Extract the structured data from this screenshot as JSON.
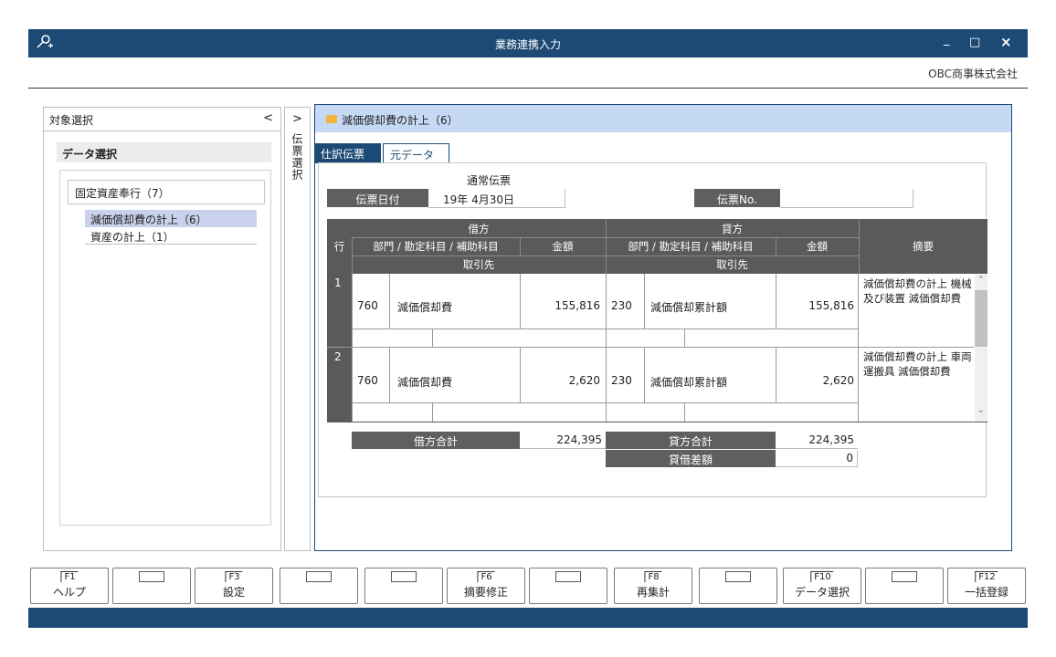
{
  "window": {
    "title": "業務連携入力",
    "icon": "key-plus-icon",
    "minimize": "_",
    "maximize": "□",
    "close": "×"
  },
  "company": "OBC商事株式会社",
  "left_panel": {
    "title": "対象選択",
    "collapse_glyph": "<",
    "section": "データ選択",
    "tree": {
      "root": "固定資産奉行（7）",
      "items": [
        {
          "label": "減価償却費の計上（6）",
          "selected": true
        },
        {
          "label": "資産の計上（1）",
          "selected": false
        }
      ]
    }
  },
  "vtab": {
    "arrow": ">",
    "label": "伝票選択"
  },
  "main": {
    "folder_title": "減価償却費の計上（6）",
    "tabs": [
      "仕訳伝票",
      "元データ"
    ],
    "voucher_type": "通常伝票",
    "date_label": "伝票日付",
    "date_value": "19年 4月30日",
    "no_label": "伝票No.",
    "no_value": "",
    "grid": {
      "row_header": "行",
      "debit_header": "借方",
      "credit_header": "貸方",
      "account_header": "部門 / 勘定科目 / 補助科目",
      "amount_header": "金額",
      "partner_header": "取引先",
      "memo_header": "摘要",
      "rows": [
        {
          "no": "1",
          "debit_dept": "760",
          "debit_account": "減価償却費",
          "debit_amount": "155,816",
          "credit_dept": "230",
          "credit_account": "減価償却累計額",
          "credit_amount": "155,816",
          "memo": "減価償却費の計上 機械及び装置 減価償却費"
        },
        {
          "no": "2",
          "debit_dept": "760",
          "debit_account": "減価償却費",
          "debit_amount": "2,620",
          "credit_dept": "230",
          "credit_account": "減価償却累計額",
          "credit_amount": "2,620",
          "memo": "減価償却費の計上 車両運搬具 減価償却費"
        }
      ]
    },
    "totals": {
      "debit_label": "借方合計",
      "debit_value": "224,395",
      "credit_label": "貸方合計",
      "credit_value": "224,395",
      "diff_label": "貸借差額",
      "diff_value": "0"
    }
  },
  "fkeys": [
    {
      "key": "F1",
      "label": "ヘルプ"
    },
    {
      "key": "",
      "label": ""
    },
    {
      "key": "F3",
      "label": "設定"
    },
    {
      "key": "",
      "label": ""
    },
    {
      "key": "",
      "label": ""
    },
    {
      "key": "F6",
      "label": "摘要修正"
    },
    {
      "key": "",
      "label": ""
    },
    {
      "key": "F8",
      "label": "再集計"
    },
    {
      "key": "",
      "label": ""
    },
    {
      "key": "F10",
      "label": "データ選択"
    },
    {
      "key": "",
      "label": ""
    },
    {
      "key": "F12",
      "label": "一括登録"
    }
  ]
}
